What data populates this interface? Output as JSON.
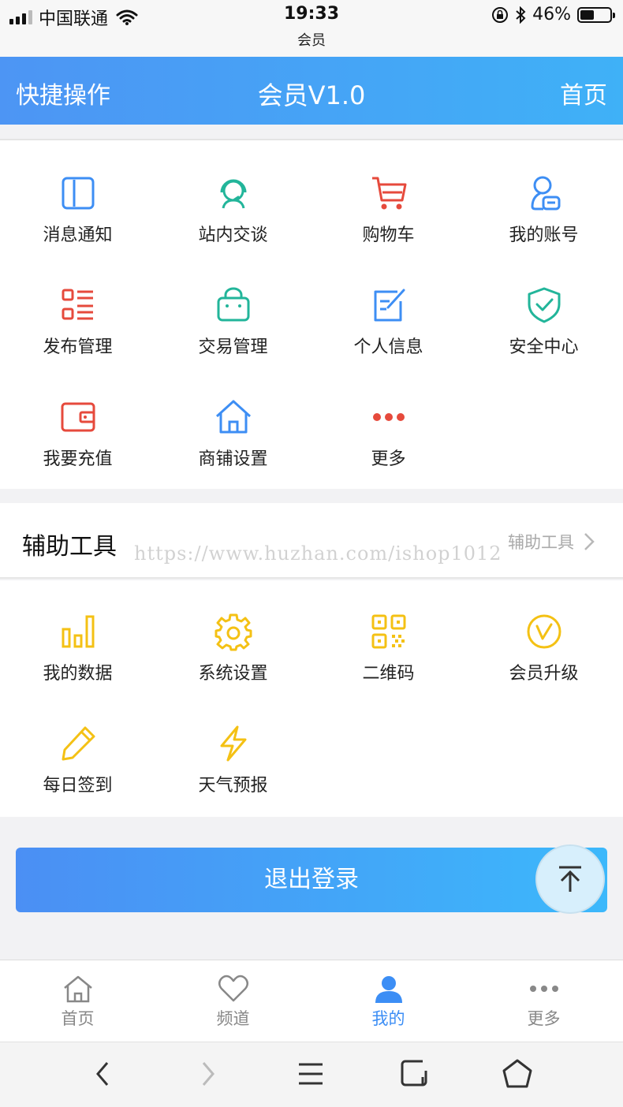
{
  "status_bar": {
    "carrier": "中国联通",
    "time": "19:33",
    "subtitle": "会员",
    "battery": "46%",
    "battery_level": 0.46
  },
  "header": {
    "left": "快捷操作",
    "title": "会员V1.0",
    "right": "首页"
  },
  "quick_actions": [
    {
      "label": "消息通知",
      "icon": "book-icon",
      "color": "#3d8ef4"
    },
    {
      "label": "站内交谈",
      "icon": "headset-icon",
      "color": "#22b59a"
    },
    {
      "label": "购物车",
      "icon": "cart-icon",
      "color": "#e64a3c"
    },
    {
      "label": "我的账号",
      "icon": "user-card-icon",
      "color": "#3d8ef4"
    },
    {
      "label": "发布管理",
      "icon": "list-icon",
      "color": "#e64a3c"
    },
    {
      "label": "交易管理",
      "icon": "bag-icon",
      "color": "#22b59a"
    },
    {
      "label": "个人信息",
      "icon": "edit-icon",
      "color": "#3d8ef4"
    },
    {
      "label": "安全中心",
      "icon": "shield-icon",
      "color": "#22b59a"
    },
    {
      "label": "我要充值",
      "icon": "wallet-icon",
      "color": "#e64a3c"
    },
    {
      "label": "商铺设置",
      "icon": "house-icon",
      "color": "#3d8ef4"
    },
    {
      "label": "更多",
      "icon": "more-dots-icon",
      "color": "#e64a3c"
    }
  ],
  "tools_section": {
    "title": "辅助工具",
    "more_label": "辅助工具",
    "watermark": "https://www.huzhan.com/ishop1012",
    "items": [
      {
        "label": "我的数据",
        "icon": "bar-chart-icon",
        "color": "#f4c114"
      },
      {
        "label": "系统设置",
        "icon": "gear-icon",
        "color": "#f4c114"
      },
      {
        "label": "二维码",
        "icon": "qrcode-icon",
        "color": "#f4c114"
      },
      {
        "label": "会员升级",
        "icon": "upgrade-icon",
        "color": "#f4c114"
      },
      {
        "label": "每日签到",
        "icon": "pencil-icon",
        "color": "#f4c114"
      },
      {
        "label": "天气预报",
        "icon": "lightning-icon",
        "color": "#f4c114"
      }
    ]
  },
  "logout_label": "退出登录",
  "tabbar": [
    {
      "label": "首页",
      "icon": "home-icon",
      "active": false
    },
    {
      "label": "频道",
      "icon": "heart-icon",
      "active": false
    },
    {
      "label": "我的",
      "icon": "person-icon",
      "active": true
    },
    {
      "label": "更多",
      "icon": "more-dots-icon",
      "active": false
    }
  ],
  "colors": {
    "accent": "#3c8ef5",
    "header_gradient_start": "#4d95f4",
    "header_gradient_end": "#3fb1f7",
    "red": "#e64a3c",
    "green": "#22b59a",
    "yellow": "#f4c114"
  }
}
